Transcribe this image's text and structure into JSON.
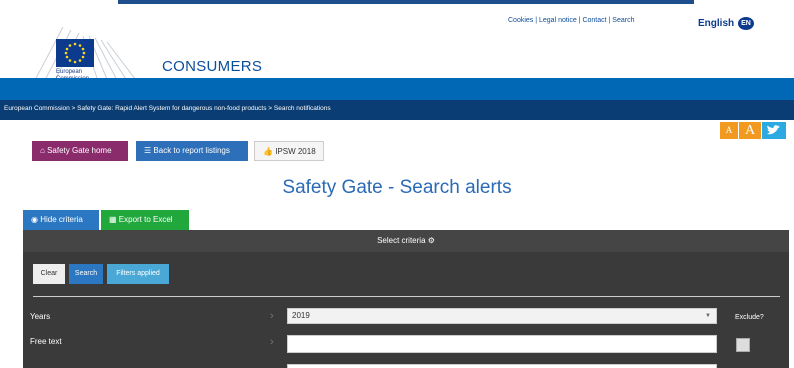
{
  "header": {
    "toplinks": "Cookies | Legal notice | Contact | Search",
    "language": "English",
    "language_code": "EN",
    "logo_text": "European Commission",
    "brand": "CONSUMERS",
    "breadcrumb": "European Commission > Safety Gate: Rapid Alert System for dangerous non-food products > Search notifications"
  },
  "tools": {
    "font_small": "A",
    "font_large": "A",
    "twitter_icon": "twitter-icon"
  },
  "nav": {
    "home": "Safety Gate home",
    "back": "Back to report listings",
    "ipsw": "IPSW 2018"
  },
  "page": {
    "title": "Safety Gate - Search alerts"
  },
  "tabs": {
    "hide": "Hide criteria",
    "export": "Export to Excel"
  },
  "criteria": {
    "header": "Select criteria",
    "clear": "Clear",
    "search": "Search",
    "filters": "Filters applied",
    "years_label": "Years",
    "years_value": "2019",
    "free_text_label": "Free text",
    "exclude_label": "Exclude?"
  },
  "colors": {
    "brand_blue": "#0068b4",
    "crumb_navy": "#0a3d73",
    "home_purple": "#8a2c6c",
    "excel_green": "#22a73d",
    "panel_dark": "#3a3a3a"
  }
}
